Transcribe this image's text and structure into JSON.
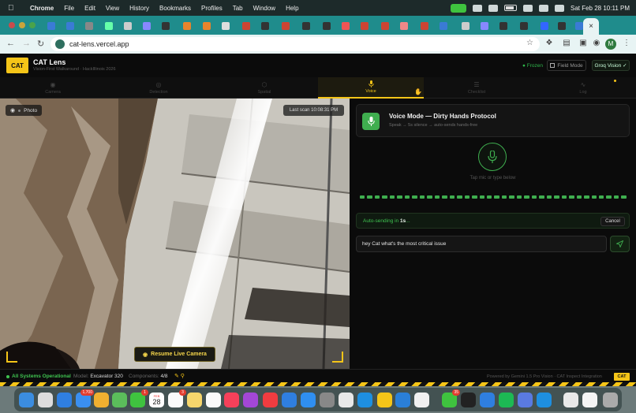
{
  "menubar": {
    "apple_icon": "apple-icon",
    "items": [
      "Chrome",
      "File",
      "Edit",
      "View",
      "History",
      "Bookmarks",
      "Profiles",
      "Tab",
      "Window",
      "Help"
    ],
    "datetime": "Sat Feb 28  10:11 PM"
  },
  "browser": {
    "url": "cat-lens.vercel.app",
    "profile_initial": "M",
    "tab_close": "×",
    "new_tab": "+"
  },
  "app": {
    "logo": "CAT",
    "title": "CAT Lens",
    "subtitle": "Vision-First Walkaround · HackIllinois 2026",
    "frozen_label": "Frozen",
    "field_mode_label": "Field Mode",
    "groq_label": "Groq Vision ✓",
    "accent_color": "#f5c518",
    "success_color": "#3fae4f"
  },
  "tabs": [
    {
      "label": "Camera",
      "icon": "camera-icon",
      "glyph": "◉"
    },
    {
      "label": "Detection",
      "icon": "eye-icon",
      "glyph": "◎"
    },
    {
      "label": "Spatial",
      "icon": "cube-icon",
      "glyph": "⬡"
    },
    {
      "label": "Voice",
      "icon": "mic-icon",
      "glyph": "🎙"
    },
    {
      "label": "Checklist",
      "icon": "list-icon",
      "glyph": "☰"
    },
    {
      "label": "Log",
      "icon": "activity-icon",
      "glyph": "∿"
    }
  ],
  "active_tab": "Voice",
  "camera": {
    "mode_label": "Photo",
    "last_scan": "Last scan 10:08:31 PM",
    "resume_label": "Resume Live Camera"
  },
  "voice": {
    "title": "Voice Mode — Dirty Hands Protocol",
    "subtitle": "Speak → 5s silence → auto-sends hands-free",
    "tap_hint": "Tap mic or type below",
    "auto_send_prefix": "Auto-sending in ",
    "auto_send_seconds": "1s",
    "auto_send_suffix": "...",
    "cancel_label": "Cancel",
    "input_value": "hey Cat what's the most critical issue",
    "send_icon": "send-icon"
  },
  "status": {
    "system": "All Systems Operational",
    "model_label": "Model:",
    "model_value": "Excavator 320",
    "components_label": "Components:",
    "components_value": "4/8",
    "powered_by": "Powered by Gemini 1.5 Pro Vision · CAT Inspect Integration",
    "badge": "CAT"
  },
  "dock": {
    "badges": {
      "mail": "1,700",
      "calendar_day": "28",
      "calendar_month": "FEB",
      "facetime": "1",
      "reminders": "3",
      "messages": "35"
    }
  }
}
